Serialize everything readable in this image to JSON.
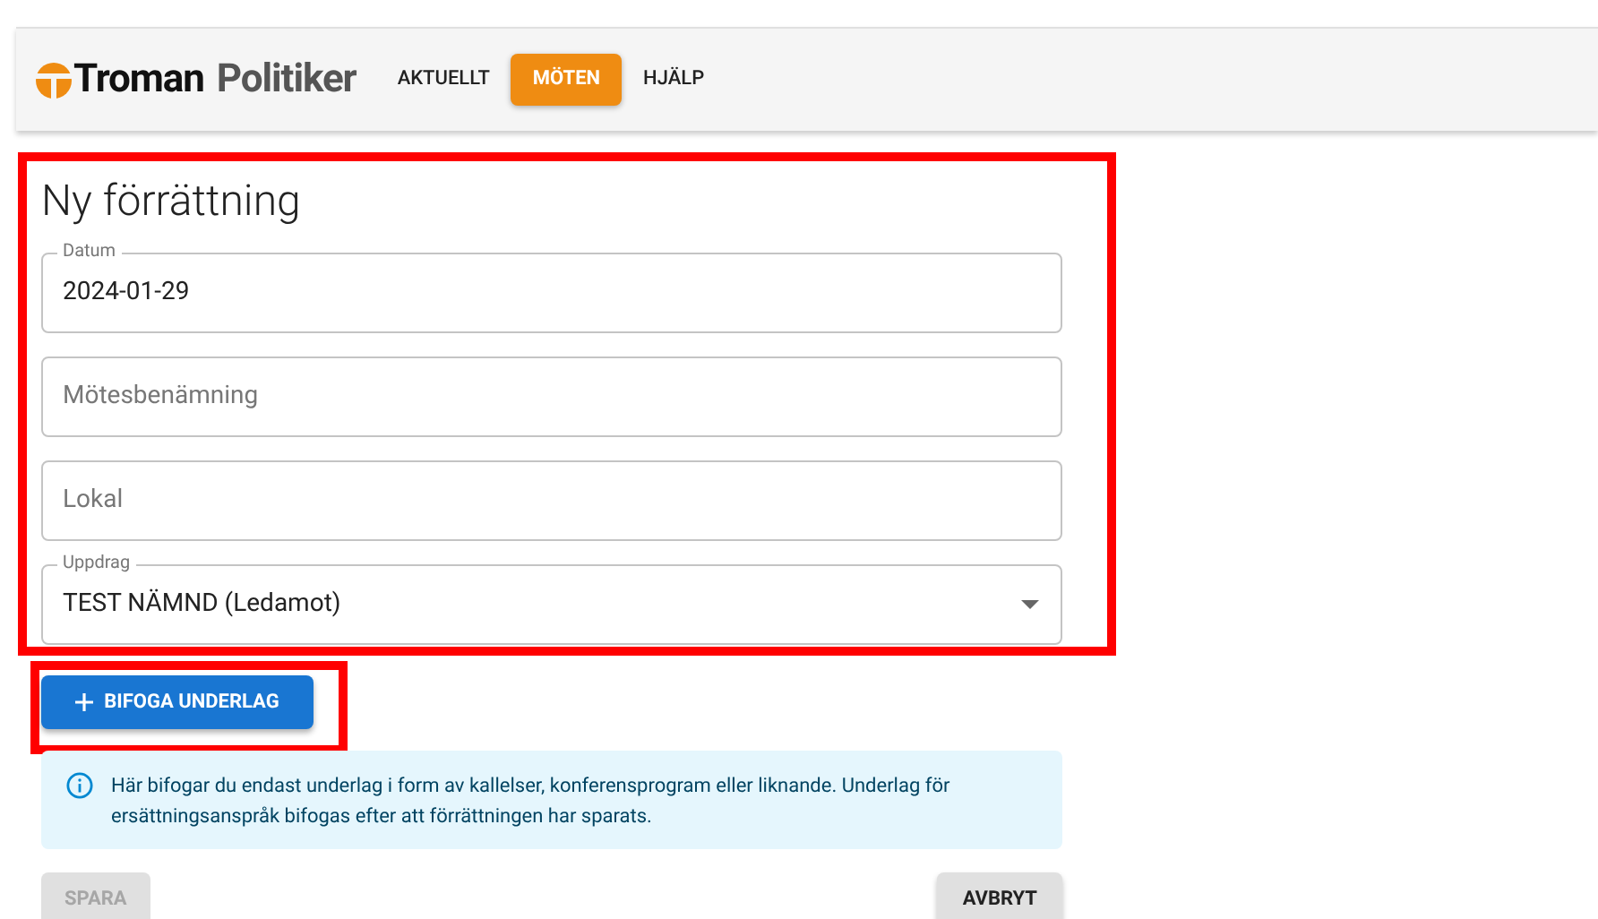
{
  "header": {
    "logo": {
      "brand": "Troman",
      "product": "Politiker"
    },
    "nav": [
      {
        "label": "AKTUELLT",
        "selected": false
      },
      {
        "label": "MÖTEN",
        "selected": true
      },
      {
        "label": "HJÄLP",
        "selected": false
      }
    ]
  },
  "form": {
    "title": "Ny förrättning",
    "fields": [
      {
        "kind": "text",
        "label": "Datum",
        "value": "2024-01-29"
      },
      {
        "kind": "text",
        "placeholder": "Mötesbenämning"
      },
      {
        "kind": "text",
        "placeholder": "Lokal"
      },
      {
        "kind": "select",
        "label": "Uppdrag",
        "value": "TEST NÄMND (Ledamot)"
      }
    ],
    "attach_button": "BIFOGA UNDERLAG",
    "info": "Här bifogar du endast underlag i form av kallelser, konferensprogram eller liknande. Underlag för ersättningsanspråk bifogas efter att förrättningen har sparats.",
    "actions": [
      {
        "label": "SPARA",
        "disabled": true
      },
      {
        "label": "AVBRYT",
        "disabled": false
      }
    ]
  }
}
